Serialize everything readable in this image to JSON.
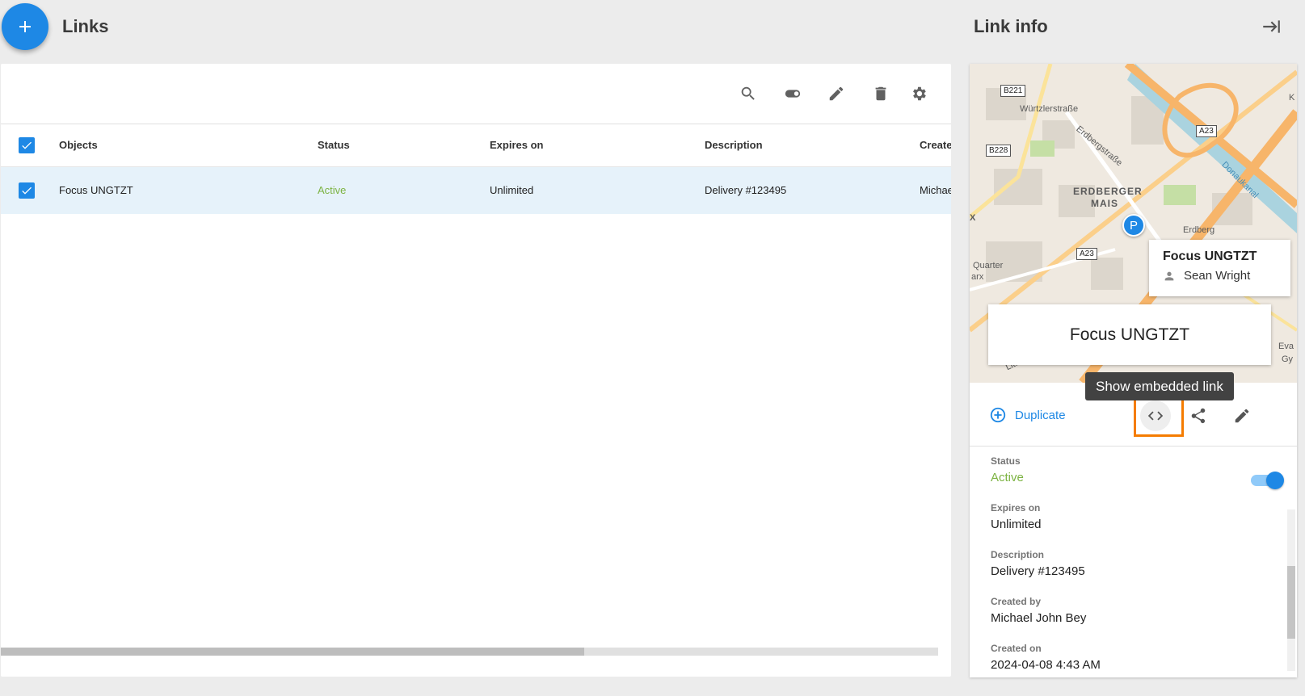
{
  "header": {
    "title": "Links"
  },
  "toolbar": {
    "icons": [
      "search-icon",
      "toggle-icon",
      "edit-icon",
      "delete-icon",
      "settings-icon"
    ]
  },
  "table": {
    "columns": [
      "Objects",
      "Status",
      "Expires on",
      "Description",
      "Create"
    ],
    "rows": [
      {
        "object": "Focus UNGTZT",
        "status": "Active",
        "expires": "Unlimited",
        "description": "Delivery #123495",
        "created_by": "Michae"
      }
    ]
  },
  "panel": {
    "title": "Link info",
    "map": {
      "labels": [
        "Würtzlerstraße",
        "Erdbergstraße",
        "ERDBERGER",
        "MAIS",
        "Donaukanal",
        "Quarter",
        "arx",
        "Erdberg",
        "Litfaß",
        "Eva",
        "Gy",
        "K",
        "X"
      ],
      "shields": [
        "B221",
        "B228",
        "A23",
        "A23"
      ],
      "pin": "P",
      "popup_title": "Focus UNGTZT",
      "popup_user": "Sean Wright"
    },
    "name_box": "Focus UNGTZT",
    "tooltip": "Show embedded link",
    "duplicate_label": "Duplicate",
    "fields": {
      "status_label": "Status",
      "status_value": "Active",
      "expires_label": "Expires on",
      "expires_value": "Unlimited",
      "description_label": "Description",
      "description_value": "Delivery #123495",
      "created_by_label": "Created by",
      "created_by_value": "Michael John Bey",
      "created_on_label": "Created on",
      "created_on_value": "2024-04-08 4:43 AM"
    }
  },
  "colors": {
    "accent": "#1e88e5",
    "active": "#7cb342",
    "highlight": "#f57c00"
  }
}
